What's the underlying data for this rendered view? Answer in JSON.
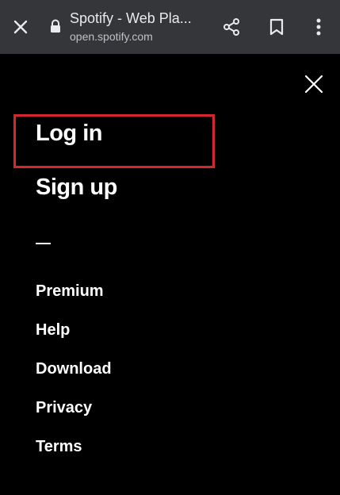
{
  "browser": {
    "page_title": "Spotify - Web Pla...",
    "url": "open.spotify.com"
  },
  "menu": {
    "login": "Log in",
    "signup": "Sign up",
    "items": [
      "Premium",
      "Help",
      "Download",
      "Privacy",
      "Terms"
    ]
  },
  "colors": {
    "browser_bar": "#35363a",
    "background": "#000000",
    "text": "#ffffff",
    "highlight": "#d4262f"
  },
  "icons": [
    "close-icon",
    "lock-icon",
    "share-icon",
    "bookmark-icon",
    "more-vert-icon",
    "menu-close-icon"
  ]
}
